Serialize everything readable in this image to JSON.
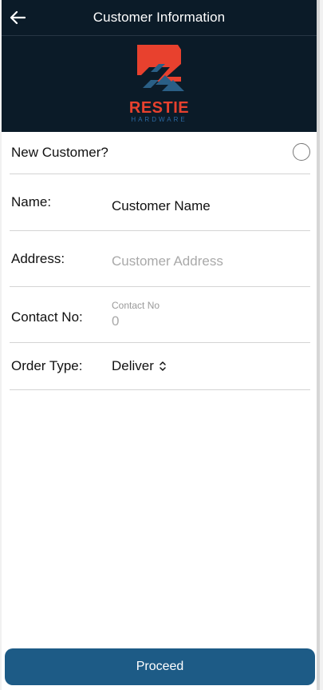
{
  "header": {
    "title": "Customer Information",
    "logo": {
      "brand": "RESTIE",
      "tagline": "HARDWARE"
    }
  },
  "form": {
    "new_customer": {
      "label": "New Customer?",
      "checked": false
    },
    "name": {
      "label": "Name:",
      "value": "Customer Name"
    },
    "address": {
      "label": "Address:",
      "placeholder": "Customer Address"
    },
    "contact": {
      "label": "Contact No:",
      "float_label": "Contact No",
      "value": "0"
    },
    "order_type": {
      "label": "Order Type:",
      "selected": "Deliver"
    }
  },
  "actions": {
    "proceed_label": "Proceed"
  },
  "colors": {
    "header_bg": "#0b1b28",
    "brand_red": "#e8412e",
    "brand_blue": "#2b6aa4",
    "button": "#1d5b86"
  }
}
